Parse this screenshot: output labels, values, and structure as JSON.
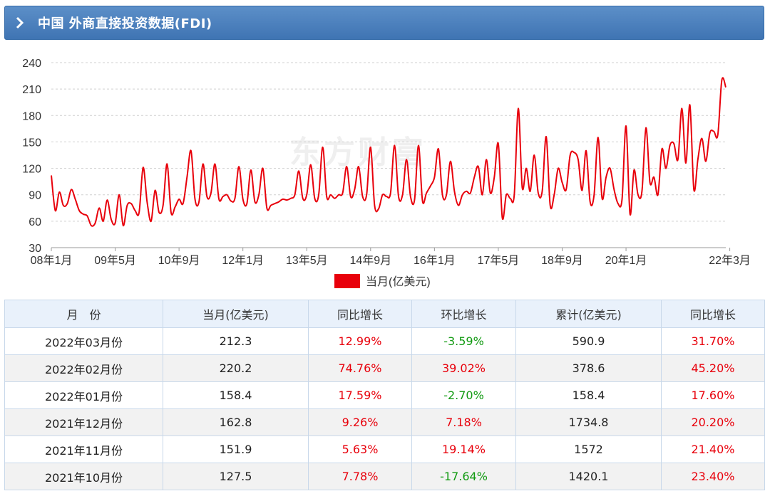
{
  "header": {
    "title": "中国 外商直接投资数据(FDI)"
  },
  "watermark": {
    "text": "东方财富"
  },
  "chart_data": {
    "type": "line",
    "legend": "当月(亿美元)",
    "legend_position": "bottom",
    "color": "#e8000b",
    "grid": true,
    "ylim": [
      30,
      240
    ],
    "yticks": [
      30,
      60,
      90,
      120,
      150,
      180,
      210,
      240
    ],
    "xtick_labels": [
      {
        "label": "08年1月",
        "index": 0
      },
      {
        "label": "09年5月",
        "index": 16
      },
      {
        "label": "10年9月",
        "index": 32
      },
      {
        "label": "12年1月",
        "index": 48
      },
      {
        "label": "13年5月",
        "index": 64
      },
      {
        "label": "14年9月",
        "index": 80
      },
      {
        "label": "16年1月",
        "index": 96
      },
      {
        "label": "17年5月",
        "index": 112
      },
      {
        "label": "18年9月",
        "index": 128
      },
      {
        "label": "20年1月",
        "index": 144
      },
      {
        "label": "22年3月",
        "index": 170
      }
    ],
    "values": [
      112,
      72,
      93,
      78,
      80,
      96,
      85,
      72,
      68,
      66,
      55,
      58,
      75,
      60,
      84,
      62,
      58,
      90,
      55,
      78,
      80,
      72,
      70,
      121,
      82,
      60,
      95,
      70,
      78,
      125,
      70,
      76,
      85,
      80,
      110,
      140,
      85,
      82,
      125,
      88,
      92,
      125,
      85,
      88,
      90,
      83,
      86,
      122,
      85,
      80,
      118,
      82,
      90,
      120,
      75,
      78,
      80,
      82,
      85,
      84,
      86,
      90,
      117,
      86,
      90,
      124,
      86,
      90,
      144,
      88,
      90,
      86,
      90,
      92,
      122,
      88,
      96,
      122,
      88,
      90,
      144,
      78,
      74,
      90,
      88,
      92,
      146,
      88,
      90,
      130,
      88,
      84,
      146,
      83,
      92,
      100,
      110,
      142,
      90,
      90,
      128,
      94,
      78,
      90,
      94,
      92,
      110,
      122,
      90,
      130,
      92,
      110,
      148,
      64,
      90,
      86,
      90,
      188,
      98,
      120,
      94,
      135,
      92,
      94,
      156,
      78,
      90,
      120,
      104,
      96,
      135,
      138,
      130,
      95,
      140,
      82,
      90,
      155,
      86,
      110,
      120,
      96,
      80,
      85,
      168,
      68,
      118,
      90,
      94,
      166,
      104,
      110,
      90,
      142,
      120,
      146,
      148,
      130,
      188,
      126,
      192,
      96,
      130,
      154,
      128,
      160,
      162,
      158,
      220,
      212
    ],
    "series_values_count": 171
  },
  "table": {
    "headers": [
      "月　份",
      "当月(亿美元)",
      "同比增长",
      "环比增长",
      "累计(亿美元)",
      "同比增长"
    ],
    "rows": [
      {
        "month": "2022年03月份",
        "current": "212.3",
        "yoy": "12.99%",
        "mom": "-3.59%",
        "cumulative": "590.9",
        "cum_yoy": "31.70%"
      },
      {
        "month": "2022年02月份",
        "current": "220.2",
        "yoy": "74.76%",
        "mom": "39.02%",
        "cumulative": "378.6",
        "cum_yoy": "45.20%"
      },
      {
        "month": "2022年01月份",
        "current": "158.4",
        "yoy": "17.59%",
        "mom": "-2.70%",
        "cumulative": "158.4",
        "cum_yoy": "17.60%"
      },
      {
        "month": "2021年12月份",
        "current": "162.8",
        "yoy": "9.26%",
        "mom": "7.18%",
        "cumulative": "1734.8",
        "cum_yoy": "20.20%"
      },
      {
        "month": "2021年11月份",
        "current": "151.9",
        "yoy": "5.63%",
        "mom": "19.14%",
        "cumulative": "1572",
        "cum_yoy": "21.40%"
      },
      {
        "month": "2021年10月份",
        "current": "127.5",
        "yoy": "7.78%",
        "mom": "-17.64%",
        "cumulative": "1420.1",
        "cum_yoy": "23.40%"
      }
    ]
  }
}
